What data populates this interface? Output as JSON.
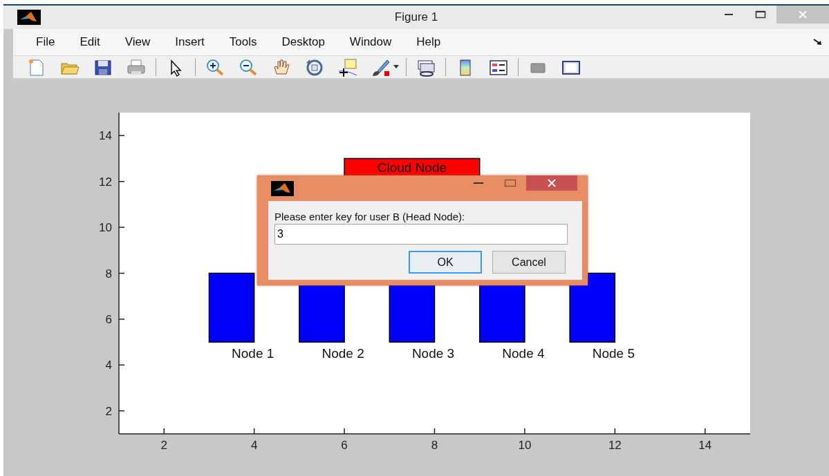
{
  "window": {
    "title": "Figure 1"
  },
  "menu": [
    "File",
    "Edit",
    "View",
    "Insert",
    "Tools",
    "Desktop",
    "Window",
    "Help"
  ],
  "axes": {
    "xticks": [
      "2",
      "4",
      "6",
      "8",
      "10",
      "12",
      "14"
    ],
    "yticks": [
      "14",
      "12",
      "10",
      "8",
      "6",
      "4",
      "2"
    ],
    "nodes": [
      {
        "kind": "cloud",
        "label": "Cloud Node",
        "color": "#ff0000"
      },
      {
        "kind": "node",
        "label": "Node 1",
        "color": "#0000ff"
      },
      {
        "kind": "node",
        "label": "Node 2",
        "color": "#0000ff"
      },
      {
        "kind": "node",
        "label": "Node 3",
        "color": "#0000ff"
      },
      {
        "kind": "node",
        "label": "Node 4",
        "color": "#0000ff"
      },
      {
        "kind": "node",
        "label": "Node 5",
        "color": "#0000ff"
      }
    ]
  },
  "dialog": {
    "prompt": "Please enter key for user B (Head Node):",
    "value": "3",
    "buttons": [
      {
        "label": "OK",
        "default": true
      },
      {
        "label": "Cancel",
        "default": false
      }
    ]
  }
}
